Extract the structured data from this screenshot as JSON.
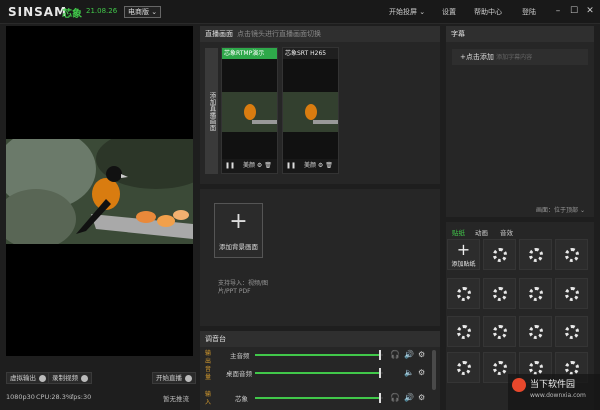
{
  "titlebar": {
    "logo": "SINSAM",
    "logo_cn": "芯象",
    "version": "21.08.26",
    "mode": "电商版",
    "menu": [
      "开始投屏",
      "设置",
      "帮助中心",
      "登陆"
    ]
  },
  "preview": {
    "left_buttons": [
      "虚拟输出",
      "录制视频"
    ],
    "start_button": "开始直播",
    "stats": {
      "resolution": "1080p30",
      "cpu": "CPU:28.3%",
      "fps": "fps:30"
    },
    "stream_status": "暂无推流"
  },
  "live": {
    "title": "直播画面",
    "subtitle": "点击镜头进行直播画面切换",
    "add_camera": "添加直播画面",
    "cameras": [
      {
        "name": "芯象RTMP演示",
        "ctl": "美颜"
      },
      {
        "name": "芯象SRT H265",
        "ctl": "美颜"
      }
    ]
  },
  "background": {
    "add_label": "添加背景画面",
    "hint": "支持导入：视频/图片/PPT PDF"
  },
  "mixer": {
    "title": "调音台",
    "group": "输出音量",
    "group2": "输入",
    "rows": [
      {
        "label": "主音频",
        "level": 0.98
      },
      {
        "label": "桌面音频",
        "level": 0.98
      },
      {
        "label": "芯象",
        "level": 0.98
      }
    ]
  },
  "captions": {
    "title": "字幕",
    "add": "+点击添加",
    "hint": "添加字幕内容",
    "position_label": "画面：",
    "position_value": "位于顶部"
  },
  "materials": {
    "tabs": [
      "贴纸",
      "动画",
      "音效"
    ],
    "active_tab": 0,
    "add_sticker": "添加贴纸",
    "tile_count": 16
  },
  "watermark": {
    "line1": "当下软件园",
    "line2": "www.downxia.com"
  }
}
